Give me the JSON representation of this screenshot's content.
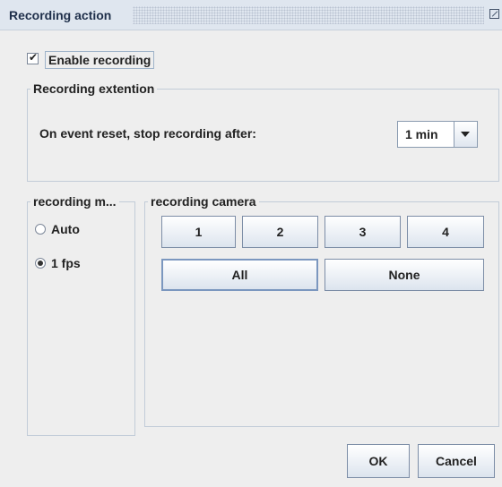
{
  "window": {
    "title": "Recording action",
    "maximize_icon": "maximize-icon"
  },
  "enable_recording": {
    "label": "Enable recording",
    "checked": true
  },
  "recording_extension": {
    "legend": "Recording extention",
    "label": "On event reset, stop recording after:",
    "selected": "1 min"
  },
  "recording_mode": {
    "legend": "recording m...",
    "options": [
      {
        "label": "Auto",
        "selected": false
      },
      {
        "label": "1 fps",
        "selected": true
      }
    ]
  },
  "recording_camera": {
    "legend": "recording camera",
    "cameras": [
      "1",
      "2",
      "3",
      "4"
    ],
    "all_label": "All",
    "none_label": "None"
  },
  "footer": {
    "ok_label": "OK",
    "cancel_label": "Cancel"
  }
}
